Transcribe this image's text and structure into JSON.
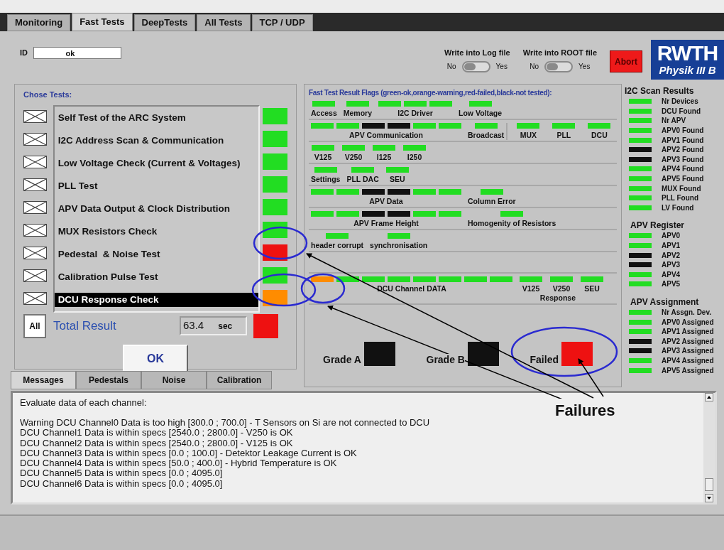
{
  "tabs": [
    {
      "label": "Monitoring",
      "selected": false
    },
    {
      "label": "Fast Tests",
      "selected": true
    },
    {
      "label": "DeepTests",
      "selected": false
    },
    {
      "label": "All Tests",
      "selected": false
    },
    {
      "label": "TCP / UDP",
      "selected": false
    }
  ],
  "id_field": {
    "label": "ID",
    "value": "ok"
  },
  "toggles": [
    {
      "title": "Write into Log file",
      "off_label": "No",
      "on_label": "Yes",
      "on": false
    },
    {
      "title": "Write into ROOT file",
      "off_label": "No",
      "on_label": "Yes",
      "on": false
    }
  ],
  "abort_button": "Abort",
  "logo": {
    "top": "RWTH",
    "bottom": "Physik III B"
  },
  "tests_panel": {
    "title": "Chose Tests:",
    "tests": [
      {
        "label": "Self Test of the ARC System",
        "selected": false,
        "color": "#22dd22"
      },
      {
        "label": "I2C Address Scan & Communication",
        "selected": false,
        "color": "#22dd22"
      },
      {
        "label": "Low Voltage Check (Current & Voltages)",
        "selected": false,
        "color": "#22dd22"
      },
      {
        "label": "PLL Test",
        "selected": false,
        "color": "#22dd22"
      },
      {
        "label": "APV Data Output & Clock Distribution",
        "selected": false,
        "color": "#22dd22"
      },
      {
        "label": "MUX Resistors Check",
        "selected": false,
        "color": "#22dd22"
      },
      {
        "label": "Pedestal  & Noise Test",
        "selected": false,
        "color": "#ee1111"
      },
      {
        "label": "Calibration Pulse Test",
        "selected": false,
        "color": "#22dd22"
      },
      {
        "label": "DCU Response Check",
        "selected": true,
        "color": "#ff8c00"
      }
    ],
    "all_button": "All",
    "total_label": "Total Result",
    "time": "63.4",
    "time_unit": "sec",
    "total": {
      "color": "#ee1111"
    },
    "ok_button": "OK"
  },
  "flags_panel": {
    "title": "Fast Test Result Flags (green-ok,orange-warning,red-failed,black-not tested):",
    "sections": [
      {
        "kind": "flags",
        "groups": [
          {
            "cells": [
              {
                "label": "Access",
                "flags": [
                  {
                    "color": "#22dd22"
                  }
                ]
              },
              {
                "label": "Memory",
                "flags": [
                  {
                    "color": "#22dd22"
                  }
                ]
              },
              {
                "label": "I2C Driver",
                "flags": [
                  {
                    "color": "#22dd22"
                  },
                  {
                    "color": "#22dd22"
                  },
                  {
                    "color": "#22dd22"
                  }
                ]
              },
              {
                "label": "Low Voltage",
                "flags": [
                  {
                    "color": "#22dd22"
                  }
                ]
              }
            ]
          }
        ]
      },
      {
        "kind": "flags",
        "groups": [
          {
            "cells": [
              {
                "label": "APV Communication",
                "flags": [
                  {
                    "color": "#22dd22"
                  },
                  {
                    "color": "#22dd22"
                  },
                  {
                    "color": "#111111"
                  },
                  {
                    "color": "#111111"
                  },
                  {
                    "color": "#22dd22"
                  },
                  {
                    "color": "#22dd22"
                  }
                ]
              },
              {
                "label": "Broadcast",
                "flags": [
                  {
                    "color": "#22dd22"
                  }
                ]
              }
            ]
          },
          {
            "cells": [
              {
                "label": "MUX",
                "flags": [
                  {
                    "color": "#22dd22"
                  }
                ]
              },
              {
                "label": "PLL",
                "flags": [
                  {
                    "color": "#22dd22"
                  }
                ]
              },
              {
                "label": "DCU",
                "flags": [
                  {
                    "color": "#22dd22"
                  }
                ]
              }
            ]
          }
        ]
      },
      {
        "kind": "flags",
        "groups": [
          {
            "cells": [
              {
                "label": "V125",
                "flags": [
                  {
                    "color": "#22dd22"
                  }
                ]
              },
              {
                "label": "V250",
                "flags": [
                  {
                    "color": "#22dd22"
                  }
                ]
              },
              {
                "label": "I125",
                "flags": [
                  {
                    "color": "#22dd22"
                  }
                ]
              },
              {
                "label": "I250",
                "flags": [
                  {
                    "color": "#22dd22"
                  }
                ]
              }
            ]
          }
        ]
      },
      {
        "kind": "flags",
        "groups": [
          {
            "cells": [
              {
                "label": "Settings",
                "flags": [
                  {
                    "color": "#22dd22"
                  }
                ]
              },
              {
                "label": "PLL DAC",
                "flags": [
                  {
                    "color": "#22dd22"
                  }
                ]
              },
              {
                "label": "SEU",
                "flags": [
                  {
                    "color": "#22dd22"
                  }
                ]
              }
            ]
          }
        ]
      },
      {
        "kind": "flags",
        "groups": [
          {
            "cells": [
              {
                "label": "APV Data",
                "flags": [
                  {
                    "color": "#22dd22"
                  },
                  {
                    "color": "#22dd22"
                  },
                  {
                    "color": "#111111"
                  },
                  {
                    "color": "#111111"
                  },
                  {
                    "color": "#22dd22"
                  },
                  {
                    "color": "#22dd22"
                  }
                ]
              },
              {
                "label": "Column Error",
                "flags": [
                  {
                    "color": "#22dd22"
                  }
                ]
              }
            ]
          }
        ]
      },
      {
        "kind": "flags",
        "groups": [
          {
            "cells": [
              {
                "label": "APV Frame Height",
                "flags": [
                  {
                    "color": "#22dd22"
                  },
                  {
                    "color": "#22dd22"
                  },
                  {
                    "color": "#111111"
                  },
                  {
                    "color": "#111111"
                  },
                  {
                    "color": "#22dd22"
                  },
                  {
                    "color": "#22dd22"
                  }
                ]
              },
              {
                "label": "Homogenity of Resistors",
                "flags": [
                  {
                    "color": "#22dd22"
                  }
                ]
              }
            ]
          }
        ]
      },
      {
        "kind": "flags",
        "groups": [
          {
            "cells": [
              {
                "label": "header corrupt",
                "flags": [
                  {
                    "color": "#22dd22"
                  }
                ]
              },
              {
                "label": "synchronisation",
                "flags": [
                  {
                    "color": "#22dd22"
                  }
                ]
              }
            ]
          }
        ]
      },
      {
        "kind": "blank"
      },
      {
        "kind": "flags",
        "note": "Response",
        "groups": [
          {
            "cells": [
              {
                "label": "DCU Channel DATA",
                "flags": [
                  {
                    "color": "#ff8c00"
                  },
                  {
                    "color": "#22dd22"
                  },
                  {
                    "color": "#22dd22"
                  },
                  {
                    "color": "#22dd22"
                  },
                  {
                    "color": "#22dd22"
                  },
                  {
                    "color": "#22dd22"
                  },
                  {
                    "color": "#22dd22"
                  },
                  {
                    "color": "#22dd22"
                  }
                ]
              },
              {
                "label": "V125",
                "flags": [
                  {
                    "color": "#22dd22"
                  }
                ]
              },
              {
                "label": "V250",
                "flags": [
                  {
                    "color": "#22dd22"
                  }
                ]
              },
              {
                "label": "SEU",
                "flags": [
                  {
                    "color": "#22dd22"
                  }
                ]
              }
            ]
          }
        ]
      }
    ],
    "grades": [
      {
        "label": "Grade A",
        "color": "#111111"
      },
      {
        "label": "Grade B",
        "color": "#111111"
      },
      {
        "label": "Failed",
        "color": "#ee1111"
      }
    ]
  },
  "scan_results": [
    {
      "title": "I2C Scan Results",
      "items": [
        {
          "label": "Nr Devices",
          "color": "#22dd22"
        },
        {
          "label": "DCU Found",
          "color": "#22dd22"
        },
        {
          "label": "Nr APV",
          "color": "#22dd22"
        },
        {
          "label": "APV0 Found",
          "color": "#22dd22"
        },
        {
          "label": "APV1 Found",
          "color": "#22dd22"
        },
        {
          "label": "APV2 Found",
          "color": "#111111"
        },
        {
          "label": "APV3 Found",
          "color": "#111111"
        },
        {
          "label": "APV4 Found",
          "color": "#22dd22"
        },
        {
          "label": "APV5 Found",
          "color": "#22dd22"
        },
        {
          "label": "MUX Found",
          "color": "#22dd22"
        },
        {
          "label": "PLL Found",
          "color": "#22dd22"
        },
        {
          "label": "LV Found",
          "color": "#22dd22"
        }
      ]
    },
    {
      "title": "APV Register",
      "items": [
        {
          "label": "APV0",
          "color": "#22dd22"
        },
        {
          "label": "APV1",
          "color": "#22dd22"
        },
        {
          "label": "APV2",
          "color": "#111111"
        },
        {
          "label": "APV3",
          "color": "#111111"
        },
        {
          "label": "APV4",
          "color": "#22dd22"
        },
        {
          "label": "APV5",
          "color": "#22dd22"
        }
      ]
    },
    {
      "title": "APV Assignment",
      "items": [
        {
          "label": "Nr Assgn. Dev.",
          "color": "#22dd22"
        },
        {
          "label": "APV0 Assigned",
          "color": "#22dd22"
        },
        {
          "label": "APV1 Assigned",
          "color": "#22dd22"
        },
        {
          "label": "APV2 Assigned",
          "color": "#111111"
        },
        {
          "label": "APV3 Assigned",
          "color": "#111111"
        },
        {
          "label": "APV4 Assigned",
          "color": "#22dd22"
        },
        {
          "label": "APV5 Assigned",
          "color": "#22dd22"
        }
      ]
    }
  ],
  "bottom_tabs": [
    {
      "label": "Messages",
      "selected": true
    },
    {
      "label": "Pedestals",
      "selected": false
    },
    {
      "label": "Noise",
      "selected": false
    },
    {
      "label": "Calibration",
      "selected": false
    }
  ],
  "messages": {
    "heading": "Evaluate data of each channel:",
    "lines": [
      "Warning DCU Channel0 Data is too high [300.0 ; 700.0] - T Sensors on Si are not connected to DCU",
      "DCU Channel1 Data is within specs [2540.0 ; 2800.0] - V250 is OK",
      "DCU Channel2 Data is within specs [2540.0 ; 2800.0] - V125 is OK",
      "DCU Channel3 Data is within specs [0.0 ; 100.0] - Detektor Leakage Current is OK",
      "DCU Channel4 Data is within specs [50.0 ; 400.0] - Hybrid Temperature is OK",
      "DCU Channel5 Data is within specs [0.0 ; 4095.0]",
      "DCU Channel6 Data is within specs [0.0 ; 4095.0]"
    ]
  },
  "annotation": {
    "text": "Failures"
  }
}
